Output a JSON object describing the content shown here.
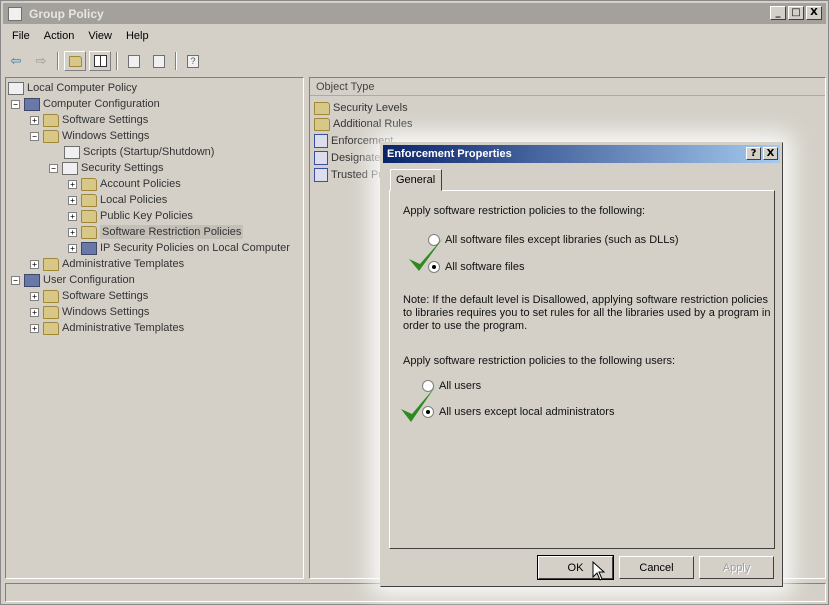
{
  "window": {
    "title": "Group Policy",
    "buttons": [
      "_",
      "□",
      "X"
    ]
  },
  "menu": [
    "File",
    "Action",
    "View",
    "Help"
  ],
  "toolbar": [
    "back-icon",
    "forward-icon",
    "up-folder-icon",
    "show-hide-tree-icon",
    "properties-icon",
    "export-list-icon",
    "help-icon"
  ],
  "tree": {
    "root": "Local Computer Policy",
    "computer_config": "Computer Configuration",
    "cc_software": "Software Settings",
    "cc_windows": "Windows Settings",
    "scripts": "Scripts (Startup/Shutdown)",
    "security": "Security Settings",
    "account": "Account Policies",
    "local": "Local Policies",
    "pubkey": "Public Key Policies",
    "srp": "Software Restriction Policies",
    "ipsec": "IP Security Policies on Local Computer",
    "cc_admin": "Administrative Templates",
    "user_config": "User Configuration",
    "uc_software": "Software Settings",
    "uc_windows": "Windows Settings",
    "uc_admin": "Administrative Templates"
  },
  "list": {
    "column": "Object Type",
    "items": [
      "Security Levels",
      "Additional Rules",
      "Enforcement",
      "Designated",
      "Trusted Pu"
    ]
  },
  "dialog": {
    "title": "Enforcement Properties",
    "tab": "General",
    "section1": "Apply software restriction policies to the following:",
    "opt1a": "All software files except libraries (such as DLLs)",
    "opt1b": "All software files",
    "note_line1": "Note:  If the default level is Disallowed, applying software restriction policies",
    "note_line2": "to libraries requires you to set rules for all the libraries used by a program in",
    "note_line3": "order to use the program.",
    "section2": "Apply software restriction policies to the following users:",
    "opt2a": "All users",
    "opt2b": "All users except local administrators",
    "ok": "OK",
    "cancel": "Cancel",
    "apply": "Apply",
    "help_btn": "?",
    "close_btn": "X"
  },
  "colors": {
    "dialog_title_start": "#0a246a",
    "dialog_title_end": "#a6caf0",
    "checkmark": "#2e8b20"
  }
}
